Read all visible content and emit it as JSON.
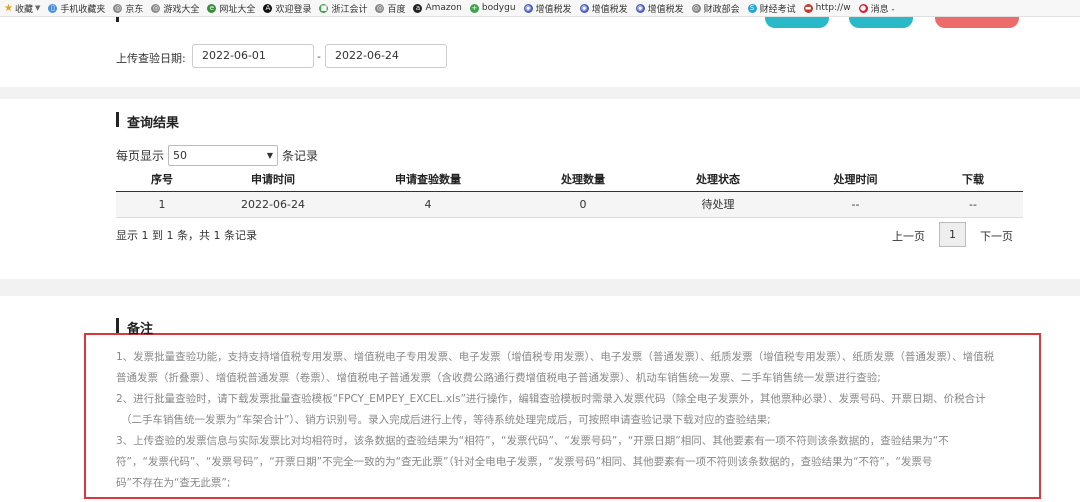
{
  "bookmarks": [
    {
      "label": "收藏",
      "icon": "star-icon",
      "color": "#e8a21a",
      "caret": true
    },
    {
      "label": "手机收藏夹",
      "icon": "phone-icon",
      "color": "#4a90d9"
    },
    {
      "label": "京东",
      "icon": "globe-icon",
      "color": "#888888"
    },
    {
      "label": "游戏大全",
      "icon": "globe-icon",
      "color": "#888888"
    },
    {
      "label": "网址大全",
      "icon": "web-directory-icon",
      "color": "#3a8f3a"
    },
    {
      "label": "欢迎登录",
      "icon": "ai-icon",
      "color": "#111111"
    },
    {
      "label": "浙江会计",
      "icon": "document-icon",
      "color": "#3fa34d"
    },
    {
      "label": "百度",
      "icon": "globe-icon",
      "color": "#888888"
    },
    {
      "label": "Amazon",
      "icon": "amazon-icon",
      "color": "#222222"
    },
    {
      "label": "bodygu",
      "icon": "plus-icon",
      "color": "#3fa34d"
    },
    {
      "label": "增值税发",
      "icon": "tax-site-icon",
      "color": "#4a5fc1"
    },
    {
      "label": "增值税发",
      "icon": "tax-site-icon",
      "color": "#4a5fc1"
    },
    {
      "label": "增值税发",
      "icon": "tax-site-icon",
      "color": "#4a5fc1"
    },
    {
      "label": "财政部会",
      "icon": "globe-icon",
      "color": "#888888"
    },
    {
      "label": "财经考试",
      "icon": "s-icon",
      "color": "#2ba3d6"
    },
    {
      "label": "http://w",
      "icon": "site-icon",
      "color": "#c0392b"
    },
    {
      "label": "消息 -",
      "icon": "weibo-icon",
      "color": "#e6162d"
    }
  ],
  "query": {
    "label": "上传查验日期:",
    "start_date": "2022-06-01",
    "separator": "-",
    "end_date": "2022-06-24"
  },
  "results": {
    "title": "查询结果",
    "per_page_prefix": "每页显示",
    "per_page_value": "50",
    "per_page_suffix": "条记录",
    "columns": [
      "序号",
      "申请时间",
      "申请查验数量",
      "处理数量",
      "处理状态",
      "处理时间",
      "下载"
    ],
    "rows": [
      [
        "1",
        "2022-06-24",
        "4",
        "0",
        "待处理",
        "--",
        "--"
      ]
    ],
    "summary": "显示 1 到 1 条，共 1 条记录",
    "pager": {
      "prev": "上一页",
      "current": "1",
      "next": "下一页"
    }
  },
  "notes": {
    "title": "备注",
    "lines": [
      "1、发票批量查验功能，支持支持增值税专用发票、增值税电子专用发票、电子发票（增值税专用发票）、电子发票（普通发票）、纸质发票（增值税专用发票）、纸质发票（普通发票）、增值税",
      "普通发票（折叠票）、增值税普通发票（卷票）、增值税电子普通发票（含收费公路通行费增值税电子普通发票）、机动车销售统一发票、二手车销售统一发票进行查验;",
      "2、进行批量查验时，请下载发票批量查验模板“FPCY_EMPEY_EXCEL.xls”进行操作，编辑查验模板时需录入发票代码（除全电子发票外，其他票种必录）、发票号码、开票日期、价税合计",
      "（二手车销售统一发票为“车架合计”）、销方识别号。录入完成后进行上传，等待系统处理完成后，可按照申请查验记录下载对应的查验结果;",
      "3、上传查验的发票信息与实际发票比对均相符时，该条数据的查验结果为“相符”，“发票代码”、“发票号码”，“开票日期”相同、其他要素有一项不符则该条数据的，查验结果为“不",
      "符”，“发票代码”、“发票号码”，“开票日期”不完全一致的为“查无此票”（针对全电电子发票，“发票号码”相同、其他要素有一项不符则该条数据的，查验结果为“不符”，“发票号",
      "码”不存在为“查无此票”;"
    ]
  },
  "colors": {
    "button_teal": "#29b9c9",
    "button_red": "#ee6b6b",
    "highlight_border": "#d9383d"
  }
}
